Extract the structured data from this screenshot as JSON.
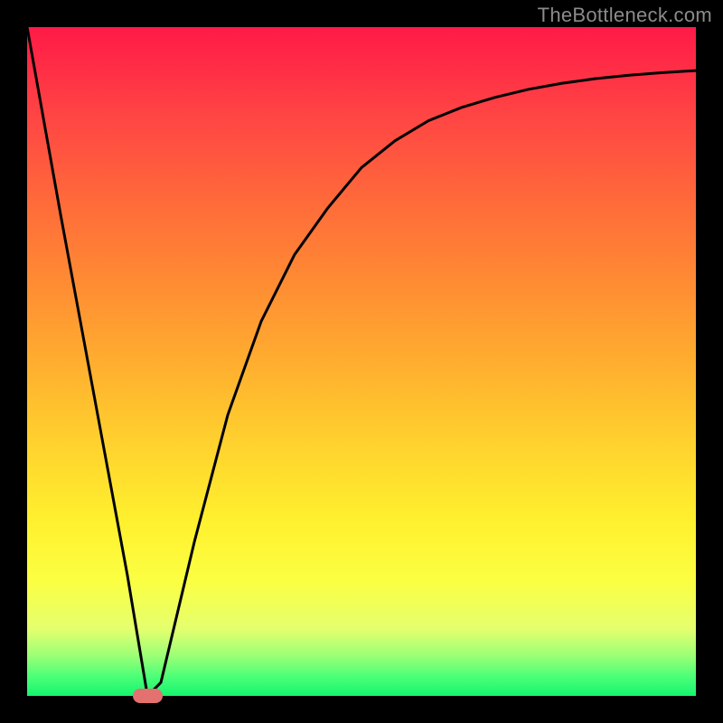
{
  "watermark": "TheBottleneck.com",
  "colors": {
    "frame": "#000000",
    "marker": "#e2716f",
    "curve": "#000000",
    "gradient_top": "#ff1a47",
    "gradient_bottom": "#14f56f"
  },
  "chart_data": {
    "type": "line",
    "title": "",
    "xlabel": "",
    "ylabel": "",
    "xlim": [
      0,
      100
    ],
    "ylim": [
      0,
      100
    ],
    "grid": false,
    "series": [
      {
        "name": "curve",
        "x": [
          0,
          5,
          10,
          15,
          18,
          20,
          25,
          30,
          35,
          40,
          45,
          50,
          55,
          60,
          65,
          70,
          75,
          80,
          85,
          90,
          95,
          100
        ],
        "y": [
          100,
          72,
          45,
          18,
          0,
          2,
          23,
          42,
          56,
          66,
          73,
          79,
          83,
          86,
          88,
          89.5,
          90.7,
          91.6,
          92.3,
          92.8,
          93.2,
          93.5
        ]
      }
    ],
    "annotations": [
      {
        "name": "optimal-marker",
        "x": 18,
        "y": 0,
        "width_pct": 4.5,
        "height_pct": 2.2
      }
    ]
  }
}
